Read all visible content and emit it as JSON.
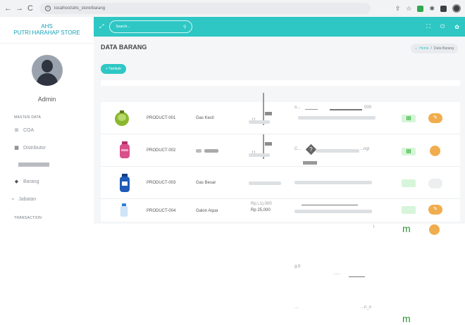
{
  "browser": {
    "url": "localhost/ahs_store/barang"
  },
  "sidebar": {
    "brand_line1": "AHS",
    "brand_line2": "PUTRI HARAHAP STORE",
    "user_name": "Admin",
    "sections": [
      {
        "label": "MASTER DATA"
      },
      {
        "label": "TRANSACTION"
      }
    ],
    "items": [
      {
        "label": "COA",
        "icon": "grid-icon"
      },
      {
        "label": "Distributor",
        "icon": "building-icon"
      },
      {
        "label": "Barang",
        "icon": "box-icon"
      },
      {
        "label": "Jabatan",
        "icon": "user-tag-icon"
      }
    ]
  },
  "topbar": {
    "search_placeholder": "Search..."
  },
  "page": {
    "title": "DATA BARANG",
    "breadcrumb_home": "Home",
    "breadcrumb_separator": "/",
    "breadcrumb_current": "Data Barang",
    "add_button": "+ Tambah"
  },
  "products": [
    {
      "code": "PRODUCT-001",
      "name": "Gas Kecil"
    },
    {
      "code": "PRODUCT-002",
      "name": ""
    },
    {
      "code": "PRODUCT-003",
      "name": "Gas Besar"
    },
    {
      "code": "PRODUCT-004",
      "name": "Galon Aqua",
      "price_top": "Rp.\\,1).000",
      "price": "Rp 25,000"
    }
  ],
  "artifacts": {
    "row1_id": "11",
    "row2_id": "11",
    "row1_fragment_left": "o...",
    "row1_fragment_right": "000",
    "row2_fragment": "C...",
    "row2_fragment_right": "...ngi",
    "row1_action": "III",
    "row2_action": "III",
    "stray_letter": "m",
    "stray_letter_2": "m",
    "stray_i": "i",
    "lower_text_1": "g.tt",
    "lower_text_2": "......",
    "lower_text_3": "...",
    "lower_text_4": "...n_o"
  },
  "colors": {
    "accent": "#2ec7c4",
    "warning": "#f0ad4e",
    "success": "#22aa22"
  }
}
